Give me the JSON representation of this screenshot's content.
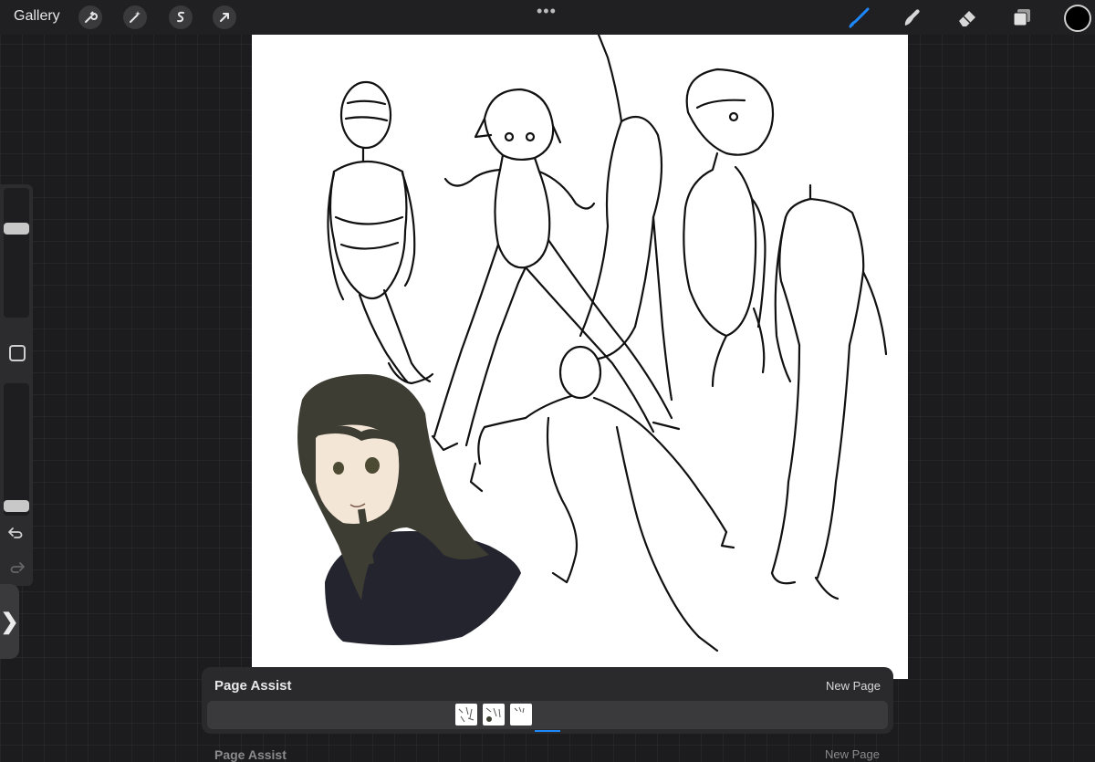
{
  "toolbar": {
    "gallery_label": "Gallery",
    "left_tools": [
      {
        "icon": "wrench-icon",
        "name": "actions"
      },
      {
        "icon": "magic-wand-icon",
        "name": "adjustments"
      },
      {
        "icon": "selection-s-icon",
        "name": "selection"
      },
      {
        "icon": "arrow-cursor-icon",
        "name": "transform"
      }
    ],
    "more_label": "•••",
    "right_tools": [
      {
        "icon": "brush-icon",
        "name": "brush",
        "active_color": "#1e88ff"
      },
      {
        "icon": "smudge-icon",
        "name": "smudge"
      },
      {
        "icon": "eraser-icon",
        "name": "eraser"
      },
      {
        "icon": "layers-icon",
        "name": "layers"
      }
    ],
    "current_color": "#000000"
  },
  "sidebar": {
    "brush_size_level": 0.72,
    "opacity_level": 0.0,
    "undo_icon": "undo-icon",
    "redo_icon": "redo-icon"
  },
  "sidebar_toggle": "❯",
  "page_assist": {
    "title": "Page Assist",
    "new_page_label": "New Page",
    "pages": [
      "page-1",
      "page-2",
      "page-3"
    ],
    "active_page_index": 2,
    "accent_color": "#1e88ff"
  }
}
